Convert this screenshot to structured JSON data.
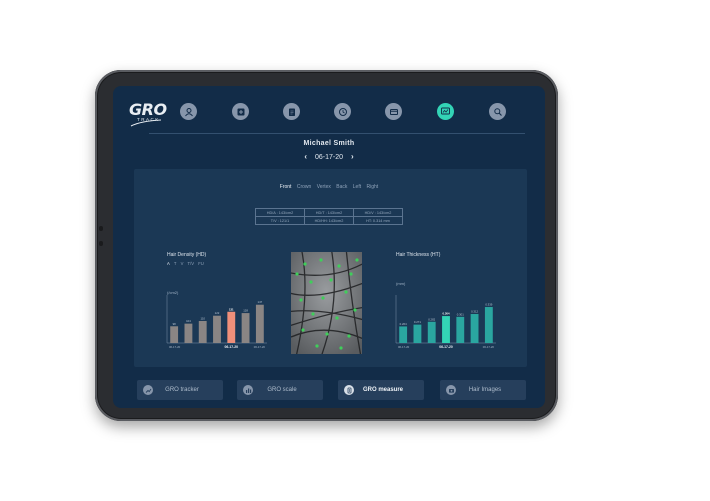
{
  "colors": {
    "accent": "#33d4b6",
    "highlight_bar": "#ef8f7a",
    "bar_gray": "#8a8584",
    "bar_teal": "#2aa6a0",
    "screen_bg": "#122c48",
    "panel_bg": "#1b3855"
  },
  "logo": {
    "brand": "GRO",
    "sub": "TRACK"
  },
  "nav": {
    "icons": [
      "user-icon",
      "medical-plus-icon",
      "clipboard-icon",
      "clock-icon",
      "card-icon",
      "scan-icon",
      "search-icon"
    ],
    "active_index": 5
  },
  "patient": {
    "name": "Michael Smith",
    "date": "06-17-20",
    "prev_arrow": "‹",
    "next_arrow": "›"
  },
  "views": {
    "items": [
      "Front",
      "Crown",
      "Vertex",
      "Back",
      "Left",
      "Right"
    ],
    "active": "Front"
  },
  "stats": {
    "row1": [
      "HD/A : 143/cm2",
      "HD/T : 143/cm2",
      "HD/V : 143/cm2"
    ],
    "row2": [
      "T/V : 121/1",
      "HD/HH: 143/cm2",
      "HT: 0.314 mm"
    ]
  },
  "density": {
    "title": "Hair Density (HD)",
    "filters": [
      "A",
      "T",
      "V",
      "T/V",
      "FU"
    ],
    "active_filter": "A",
    "unit": "(/cm2)"
  },
  "thickness": {
    "title": "Hair Thickness (HT)",
    "unit": "(mm)"
  },
  "chart_data": [
    {
      "type": "bar",
      "title": "Hair Density (HD)",
      "ylabel": "(/cm2)",
      "x_ticks": [
        "06-17-20",
        "06-17-20",
        "06-17-20"
      ],
      "values": [
        98,
        104,
        110,
        122,
        131,
        128,
        147
      ],
      "data_labels": [
        "98",
        "104",
        "110",
        "122",
        "131",
        "128",
        "147"
      ],
      "highlight_index": 4,
      "ylim": [
        60,
        160
      ]
    },
    {
      "type": "bar",
      "title": "Hair Thickness (HT)",
      "ylabel": "(mm)",
      "x_ticks": [
        "06-17-20",
        "06-17-20",
        "06-17-20"
      ],
      "values": [
        0.264,
        0.271,
        0.282,
        0.304,
        0.301,
        0.312,
        0.339
      ],
      "data_labels": [
        "0.264",
        "0.271",
        "0.282",
        "0.304",
        "0.301",
        "0.312",
        "0.339"
      ],
      "highlight_index": 3,
      "ylim": [
        0.2,
        0.37
      ]
    }
  ],
  "bottom_buttons": [
    {
      "label": "GRO tracker",
      "icon": "trend-icon",
      "active": false
    },
    {
      "label": "GRO scale",
      "icon": "scale-icon",
      "active": false
    },
    {
      "label": "GRO measure",
      "icon": "measure-icon",
      "active": true
    },
    {
      "label": "Hair Images",
      "icon": "camera-icon",
      "active": false
    }
  ]
}
